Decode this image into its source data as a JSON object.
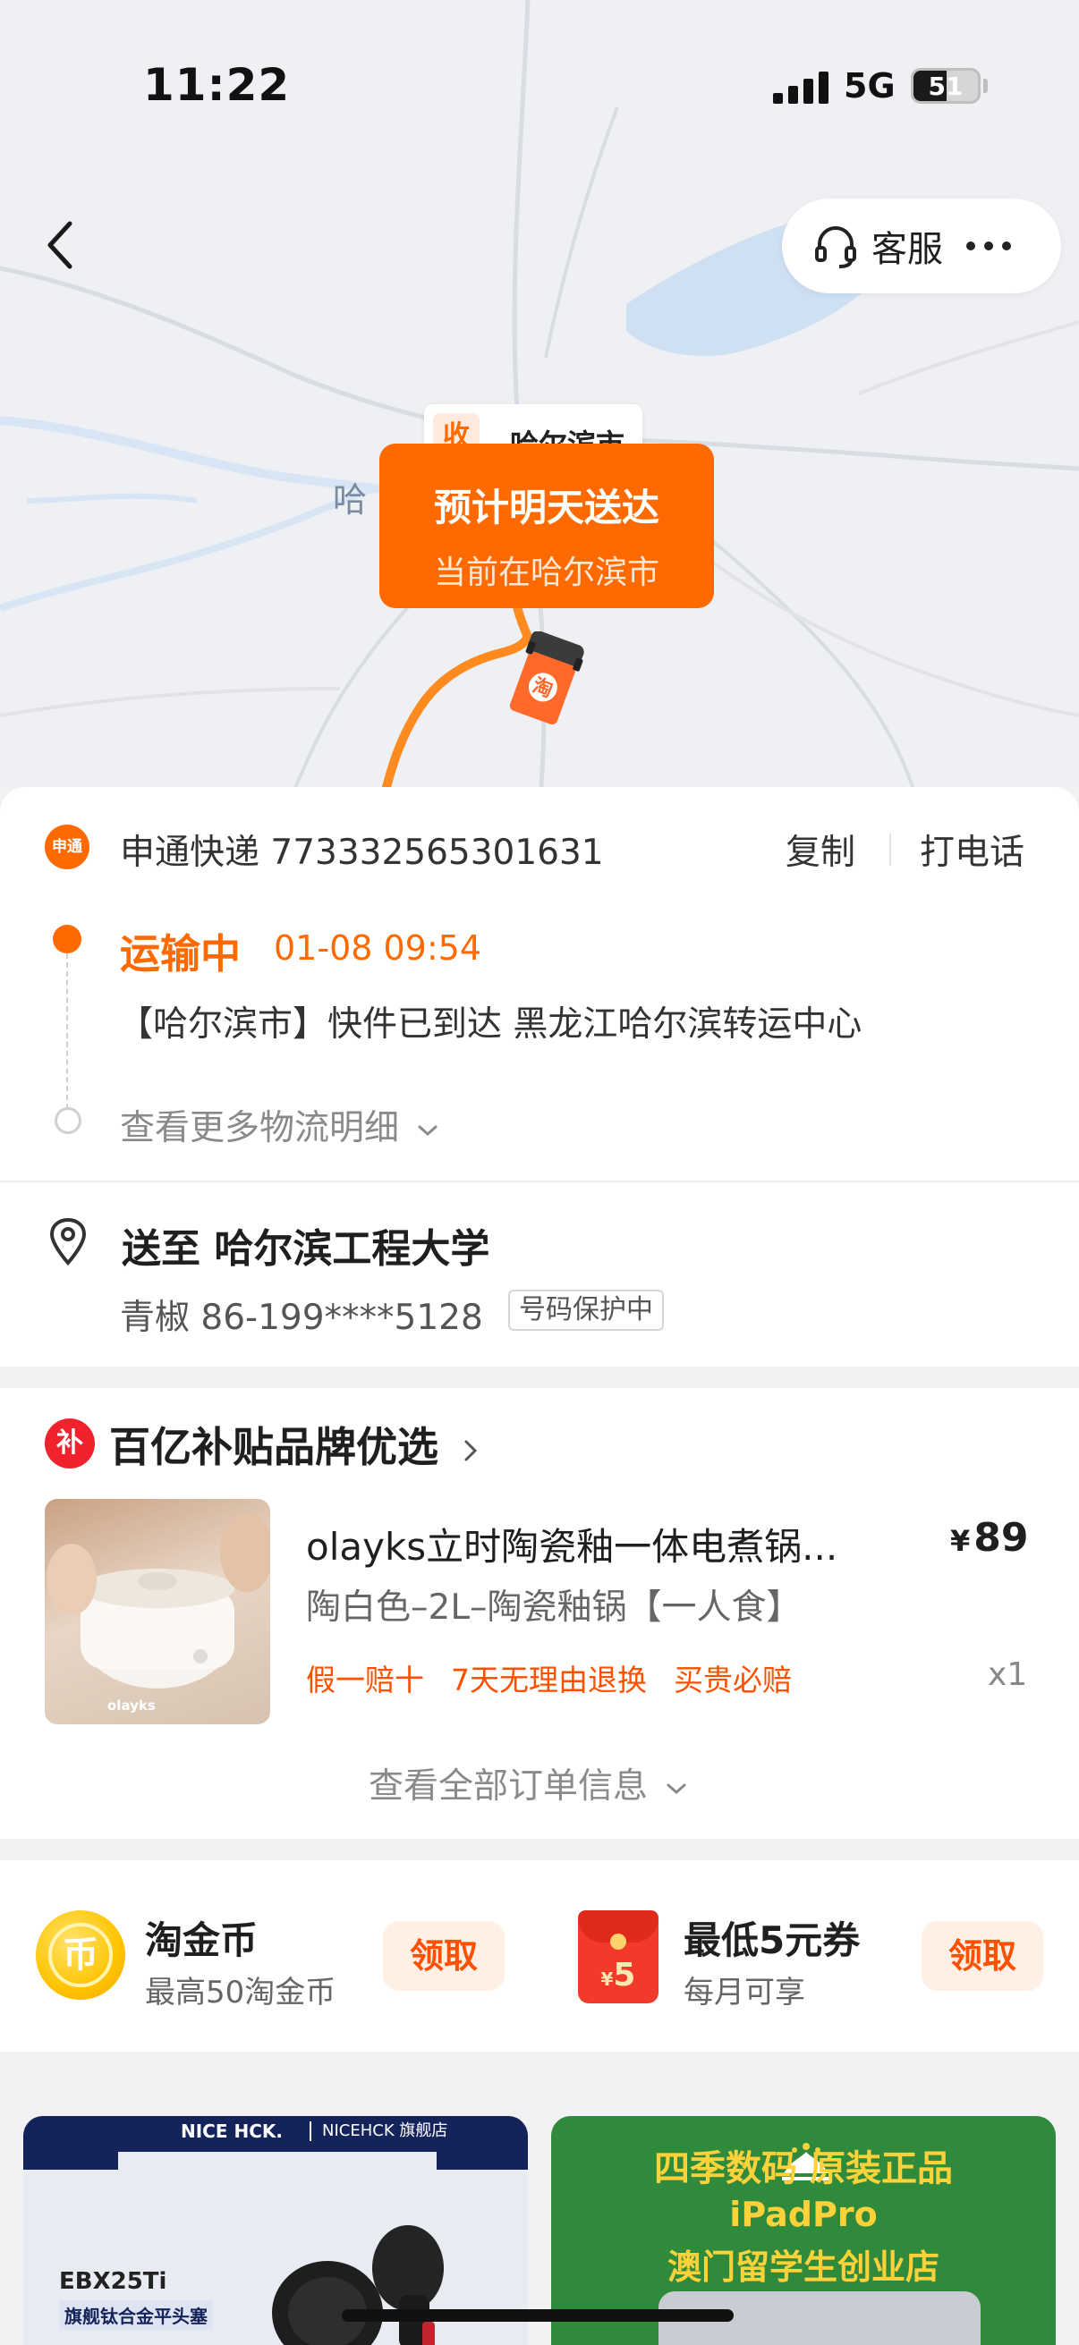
{
  "status_bar": {
    "time": "11:22",
    "network": "5G",
    "battery": "51",
    "battery_level": 0.51
  },
  "header": {
    "service_label": "客服"
  },
  "map": {
    "city_label": "哈",
    "receiver_badge": "收",
    "receiver_city": "哈尔滨市",
    "eta_title": "预计明天送达",
    "eta_subtitle": "当前在哈尔滨市",
    "truck_label": "淘"
  },
  "courier": {
    "logo_text": "申通",
    "info": "申通快递 773332565301631",
    "copy_label": "复制",
    "call_label": "打电话"
  },
  "tracking": {
    "status": "运输中",
    "time": "01-08 09:54",
    "detail": "【哈尔滨市】快件已到达 黑龙江哈尔滨转运中心",
    "more_label": "查看更多物流明细"
  },
  "address": {
    "title": "送至 哈尔滨工程大学",
    "contact": "青椒 86-199****5128",
    "privacy_badge": "号码保护中"
  },
  "order": {
    "section_icon_text": "补",
    "section_title": "百亿补贴品牌优选",
    "product": {
      "name": "olayks立时陶瓷釉一体电煮锅...",
      "currency": "¥",
      "price": "89",
      "sku": "陶白色–2L–陶瓷釉锅【一人食】",
      "tags": [
        "假一赔十",
        "7天无理由退换",
        "买贵必赔"
      ],
      "quantity": "x1",
      "image_caption": "olayks"
    },
    "view_all_label": "查看全部订单信息"
  },
  "benefits": {
    "coin": {
      "icon_text": "币",
      "title": "淘金币",
      "subtitle": "最高50淘金币",
      "button": "领取"
    },
    "coupon": {
      "icon_currency": "¥",
      "icon_amount": "5",
      "title": "最低5元券",
      "subtitle": "每月可享",
      "button": "领取"
    }
  },
  "ads": {
    "left": {
      "brand": "NICE HCK.",
      "brand_sub": "NICEHCK 旗舰店",
      "model": "EBX25Ti",
      "desc": "旗舰钛合金平头塞"
    },
    "right": {
      "line1": "四季数码    原装正品",
      "line2": "iPadPro",
      "line3": "澳门留学生创业店"
    }
  },
  "colors": {
    "accent": "#ff6a00",
    "price_tag": "#ff5000",
    "subsidy_red": "#f0222e"
  }
}
